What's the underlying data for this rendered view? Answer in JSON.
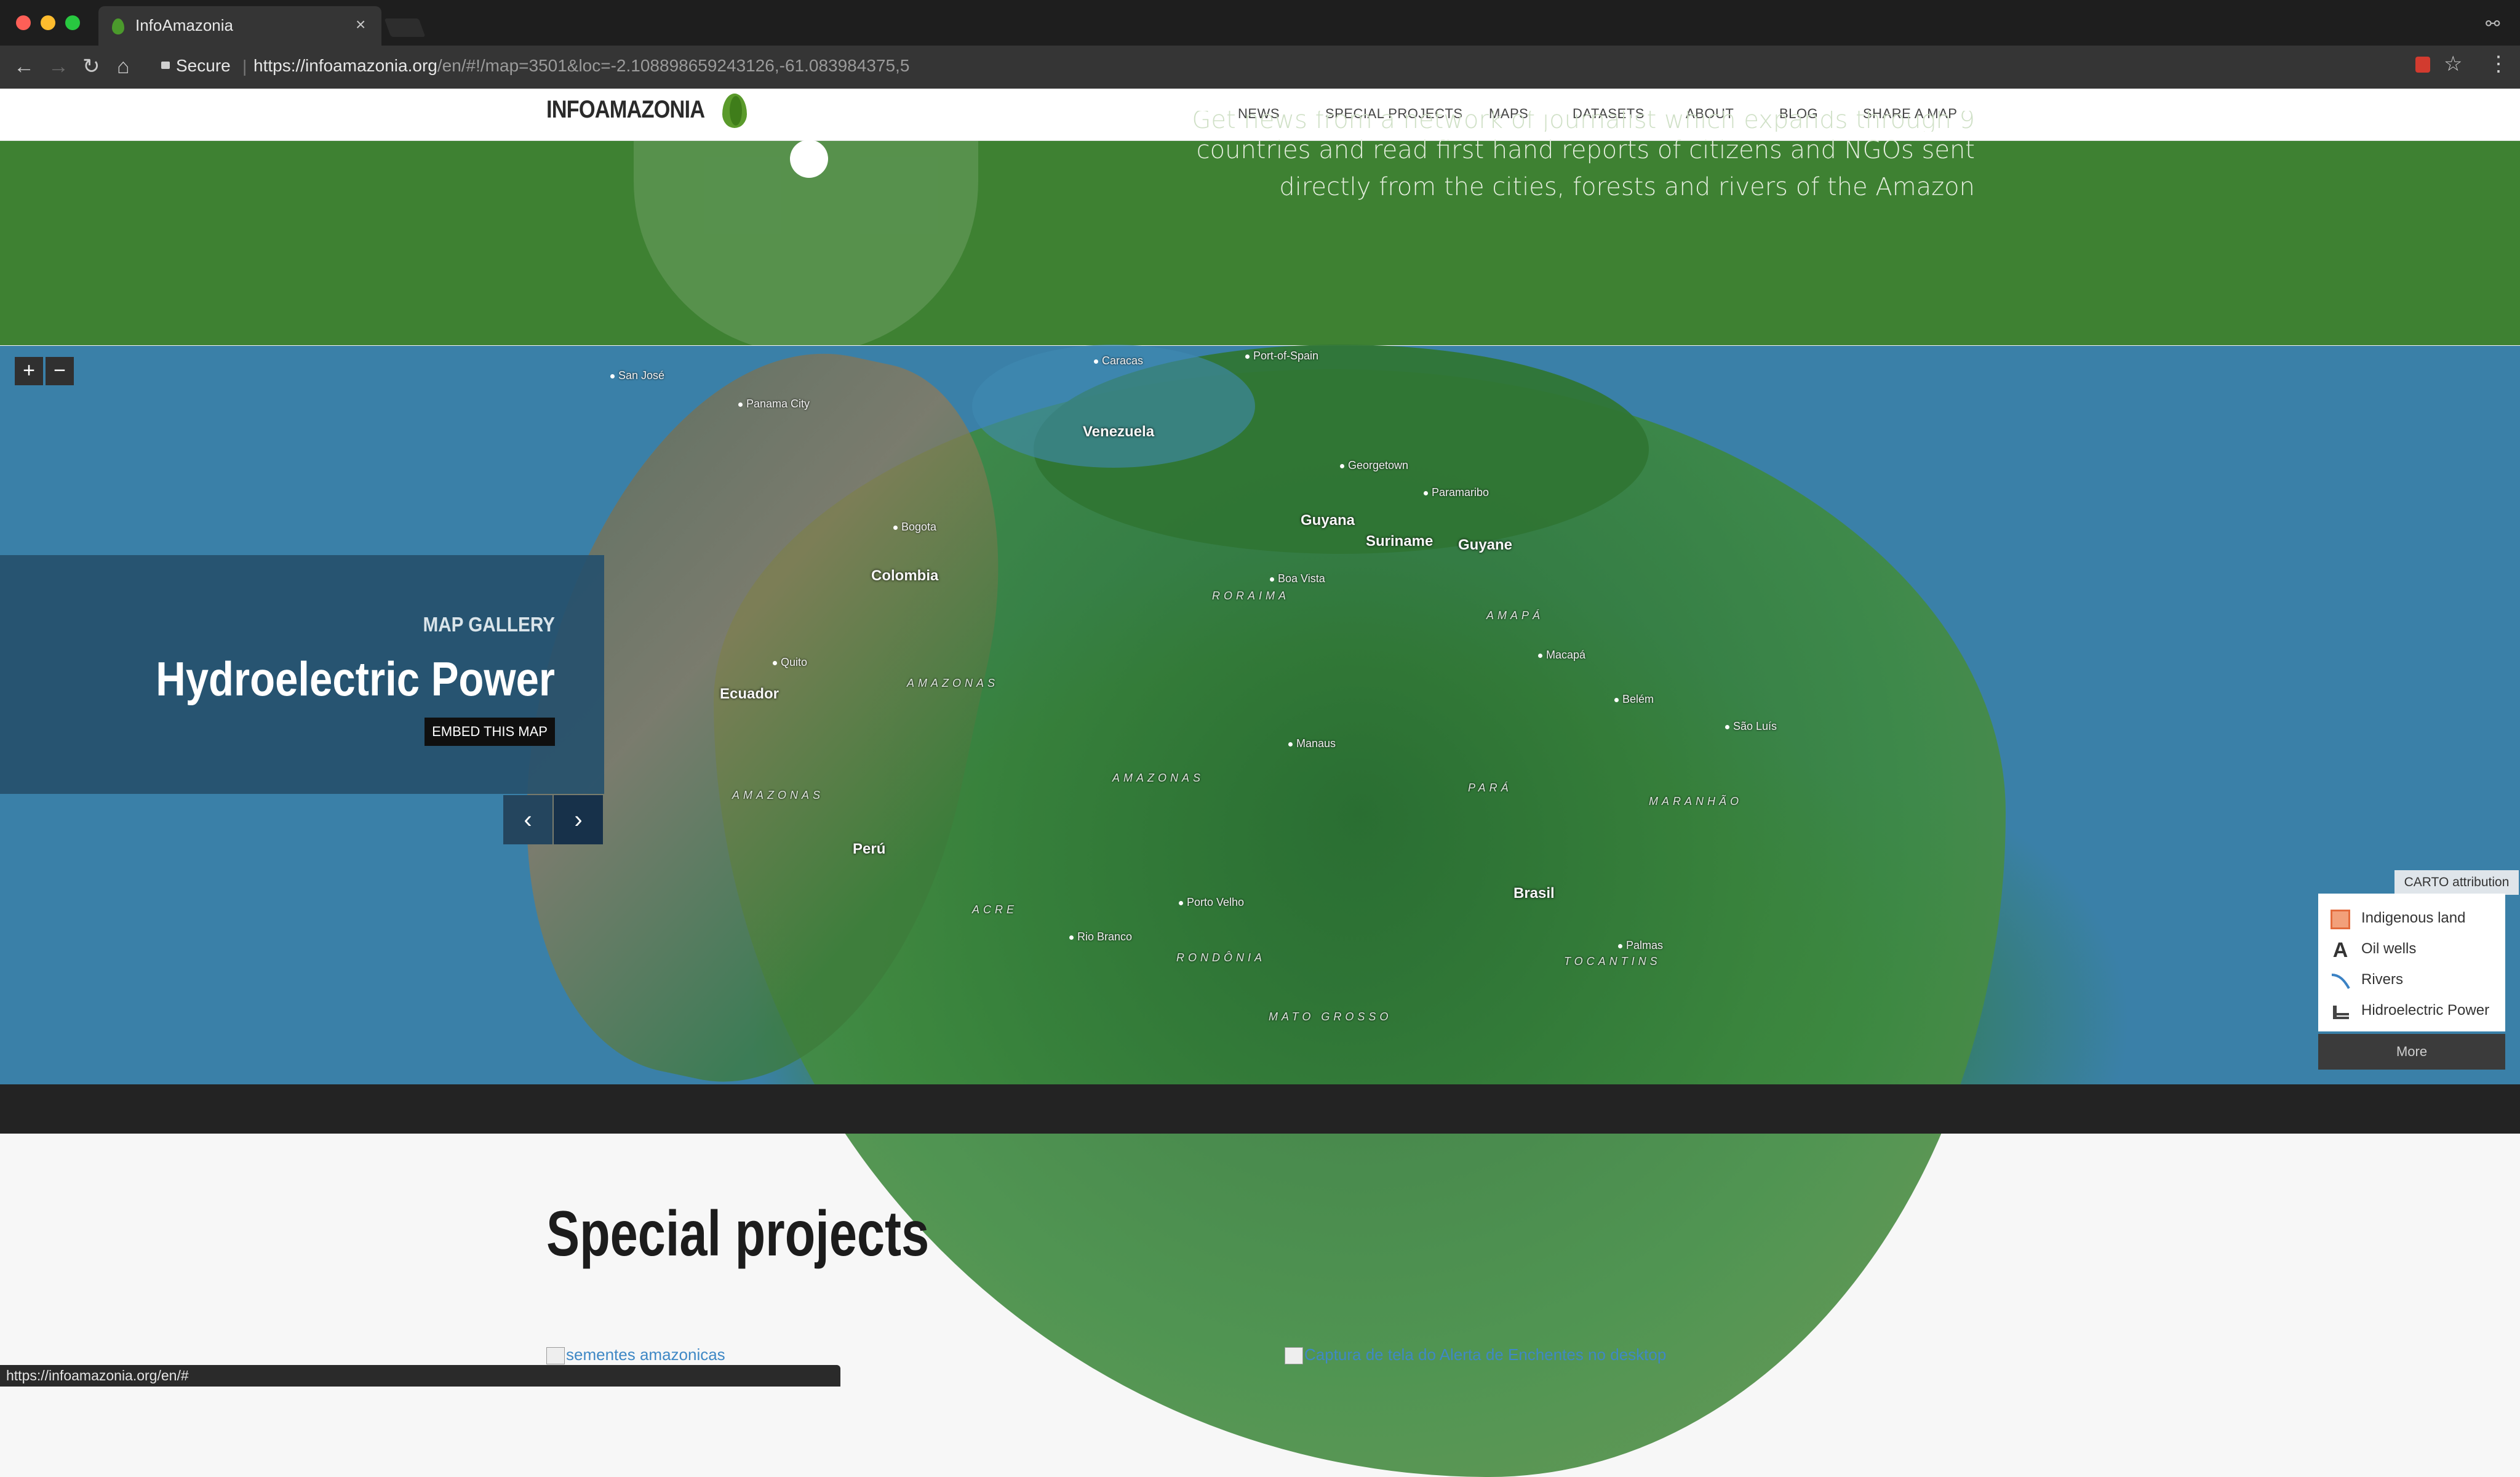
{
  "browser": {
    "tab_title": "InfoAmazonia",
    "tab_close": "×",
    "secure_label": "Secure",
    "url_host": "https://infoamazonia.org",
    "url_path": "/en/#!/map=3501&loc=-2.108898659243126,-61.083984375,5",
    "status_url": "https://infoamazonia.org/en/#"
  },
  "header": {
    "logo": "INFOAMAZONIA",
    "nav": [
      "NEWS",
      "SPECIAL PROJECTS",
      "MAPS",
      "DATASETS",
      "ABOUT",
      "BLOG",
      "SHARE A MAP"
    ]
  },
  "hero": {
    "line1": "Get news from a network of journalist which expands through 9",
    "line2": "countries and read first hand reports of citizens and NGOs sent",
    "line3": "directly from the cities, forests and rivers of the Amazon"
  },
  "map": {
    "zoom_in": "+",
    "zoom_out": "−",
    "cities": [
      "San José",
      "Panama City",
      "Caracas",
      "Port-of-Spain",
      "Georgetown",
      "Paramaribo",
      "Bogota",
      "Boa Vista",
      "Quito",
      "Macapá",
      "Belém",
      "São Luís",
      "Manaus",
      "Porto Velho",
      "Rio Branco",
      "Palmas"
    ],
    "countries": [
      "Venezuela",
      "Guyana",
      "Suriname",
      "Guyane",
      "Colombia",
      "Ecuador",
      "Perú",
      "Brasil"
    ],
    "regions": [
      "RORAIMA",
      "AMAPÁ",
      "AMAZONAS",
      "AMAZONAS",
      "AMAZONAS",
      "PARÁ",
      "MARANHÃO",
      "ACRE",
      "RONDÔNIA",
      "TOCANTINS",
      "MATO GROSSO"
    ]
  },
  "gallery": {
    "kicker": "MAP GALLERY",
    "title": "Hydroelectric Power",
    "embed_label": "EMBED THIS MAP",
    "prev_icon": "‹",
    "next_icon": "›"
  },
  "legend": {
    "attribution": "CARTO attribution",
    "items": [
      "Indigenous land",
      "Oil wells",
      "Rivers",
      "Hidroelectric Power"
    ],
    "more": "More"
  },
  "special": {
    "title": "Special projects",
    "img1_alt": "sementes amazonicas",
    "img2_alt": "Captura de tela do Alerta de Enchentes no desktop"
  }
}
